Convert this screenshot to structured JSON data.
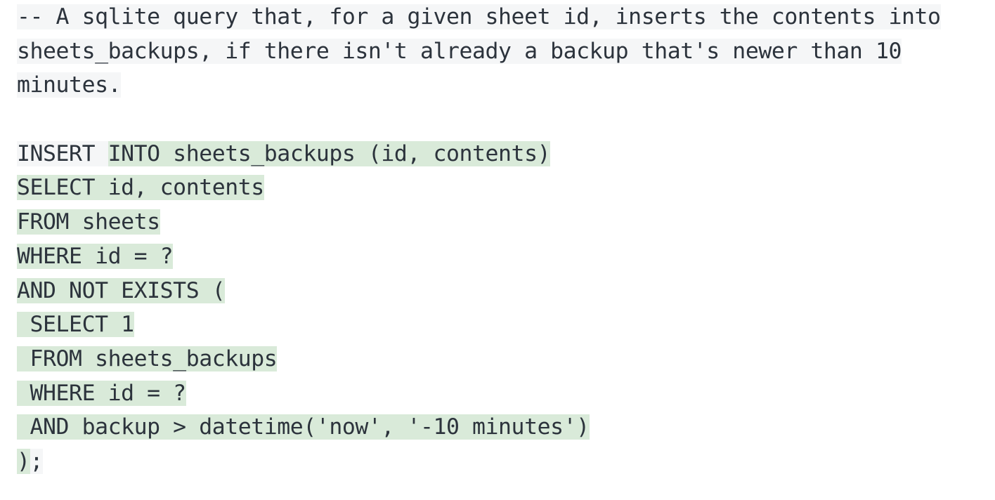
{
  "document": {
    "kind": "sql-code-snippet",
    "colors": {
      "page_background": "#ffffff",
      "text": "#2c333c",
      "highlight_gray": "#f5f6f7",
      "highlight_green": "#d9ead9"
    },
    "comment": {
      "full_text": "-- A sqlite query that, for a given sheet id, inserts the contents into sheets_backups, if there isn't already a backup that's newer than 10 minutes.",
      "wrapped_lines": [
        "-- A sqlite query that, for a given sheet id, inserts the contents into",
        "sheets_backups, if there isn't already a backup that's newer than 10",
        "minutes."
      ]
    },
    "query": {
      "full_text": "INSERT INTO sheets_backups (id, contents)\nSELECT id, contents\nFROM sheets\nWHERE id = ?\nAND NOT EXISTS (\n SELECT 1\n FROM sheets_backups\n WHERE id = ?\n AND backup > datetime('now', '-10 minutes')\n);"
    },
    "lines": [
      {
        "id": "comment-line-1",
        "segments": [
          {
            "text": "-- A sqlite query that, for a given sheet id, inserts the contents into",
            "highlight": "gray"
          }
        ]
      },
      {
        "id": "comment-line-2",
        "segments": [
          {
            "text": "sheets_backups, if there isn't already a backup that's newer than 10",
            "highlight": "gray"
          }
        ]
      },
      {
        "id": "comment-line-3",
        "segments": [
          {
            "text": "minutes.",
            "highlight": "gray"
          }
        ]
      },
      {
        "id": "blank-line",
        "segments": []
      },
      {
        "id": "sql-line-1",
        "segments": [
          {
            "text": "INSERT ",
            "highlight": "gray"
          },
          {
            "text": "INTO sheets_backups (id, contents)",
            "highlight": "green"
          }
        ]
      },
      {
        "id": "sql-line-2",
        "segments": [
          {
            "text": "SELECT id, contents",
            "highlight": "green"
          }
        ]
      },
      {
        "id": "sql-line-3",
        "segments": [
          {
            "text": "FROM sheets",
            "highlight": "green"
          }
        ]
      },
      {
        "id": "sql-line-4",
        "segments": [
          {
            "text": "WHERE id = ?",
            "highlight": "green"
          }
        ]
      },
      {
        "id": "sql-line-5",
        "segments": [
          {
            "text": "AND NOT EXISTS (",
            "highlight": "green"
          }
        ]
      },
      {
        "id": "sql-line-6",
        "segments": [
          {
            "text": " SELECT 1",
            "highlight": "green"
          }
        ]
      },
      {
        "id": "sql-line-7",
        "segments": [
          {
            "text": " FROM sheets_backups",
            "highlight": "green"
          }
        ]
      },
      {
        "id": "sql-line-8",
        "segments": [
          {
            "text": " WHERE id = ?",
            "highlight": "green"
          }
        ]
      },
      {
        "id": "sql-line-9",
        "segments": [
          {
            "text": " AND backup > datetime('now', '-10 minutes')",
            "highlight": "green"
          }
        ]
      },
      {
        "id": "sql-line-10",
        "segments": [
          {
            "text": ")",
            "highlight": "green"
          },
          {
            "text": ";",
            "highlight": "gray"
          }
        ]
      }
    ]
  }
}
